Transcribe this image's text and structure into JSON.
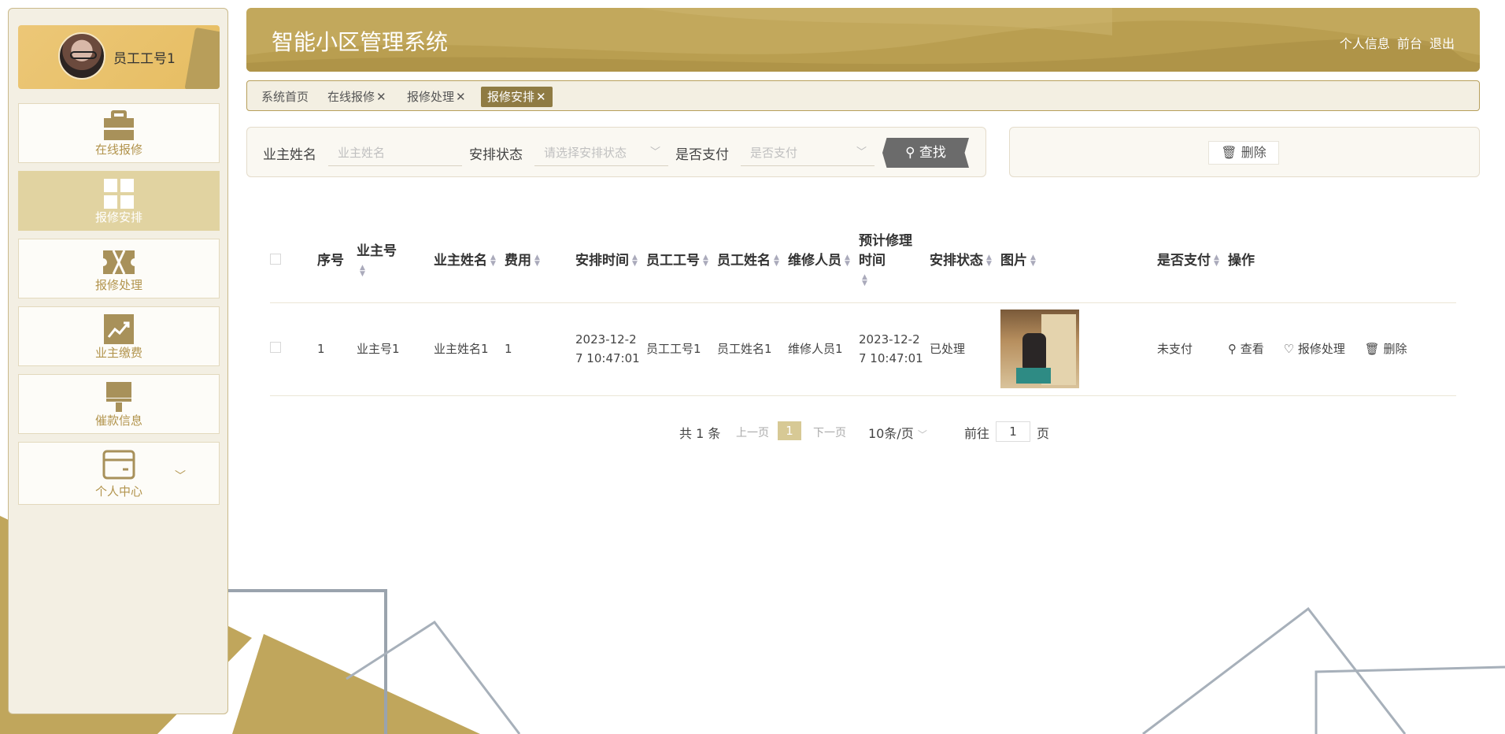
{
  "app": {
    "title": "智能小区管理系统"
  },
  "header": {
    "links": [
      "个人信息",
      "前台",
      "退出"
    ]
  },
  "user": {
    "name": "员工工号1"
  },
  "sidebar": {
    "items": [
      {
        "label": "在线报修",
        "icon": "briefcase-icon",
        "active": false
      },
      {
        "label": "报修安排",
        "icon": "grid-icon",
        "active": true
      },
      {
        "label": "报修处理",
        "icon": "ticket-icon",
        "active": false
      },
      {
        "label": "业主缴费",
        "icon": "chart-icon",
        "active": false
      },
      {
        "label": "催款信息",
        "icon": "brush-icon",
        "active": false
      },
      {
        "label": "个人中心",
        "icon": "card-icon",
        "active": false
      }
    ]
  },
  "tabs": [
    {
      "label": "系统首页",
      "closable": false,
      "active": false
    },
    {
      "label": "在线报修",
      "closable": true,
      "active": false
    },
    {
      "label": "报修处理",
      "closable": true,
      "active": false
    },
    {
      "label": "报修安排",
      "closable": true,
      "active": true
    }
  ],
  "search": {
    "owner_name_label": "业主姓名",
    "owner_name_placeholder": "业主姓名",
    "status_label": "安排状态",
    "status_placeholder": "请选择安排状态",
    "paid_label": "是否支付",
    "paid_placeholder": "是否支付",
    "search_button": "查找"
  },
  "actions": {
    "delete_button": "删除"
  },
  "table": {
    "headers": [
      "序号",
      "业主号",
      "业主姓名",
      "费用",
      "安排时间",
      "员工工号",
      "员工姓名",
      "维修人员",
      "预计修理时间",
      "安排状态",
      "图片",
      "是否支付",
      "操作"
    ],
    "rows": [
      {
        "index": "1",
        "owner_no": "业主号1",
        "owner_name": "业主姓名1",
        "fee": "1",
        "arrange_time": "2023-12-27 10:47:01",
        "staff_no": "员工工号1",
        "staff_name": "员工姓名1",
        "repairer": "维修人员1",
        "expected_time": "2023-12-27 10:47:01",
        "status": "已处理",
        "paid": "未支付",
        "ops": [
          "查看",
          "报修处理",
          "删除"
        ]
      }
    ]
  },
  "pagination": {
    "total": "共 1 条",
    "prev": "上一页",
    "current": "1",
    "next": "下一页",
    "page_size": "10条/页",
    "goto_label": "前往",
    "goto_value": "1",
    "goto_suffix": "页"
  },
  "colors": {
    "accent": "#c2a85c",
    "tab_active": "#8f7b43",
    "menu_active": "#e1d3a1"
  }
}
